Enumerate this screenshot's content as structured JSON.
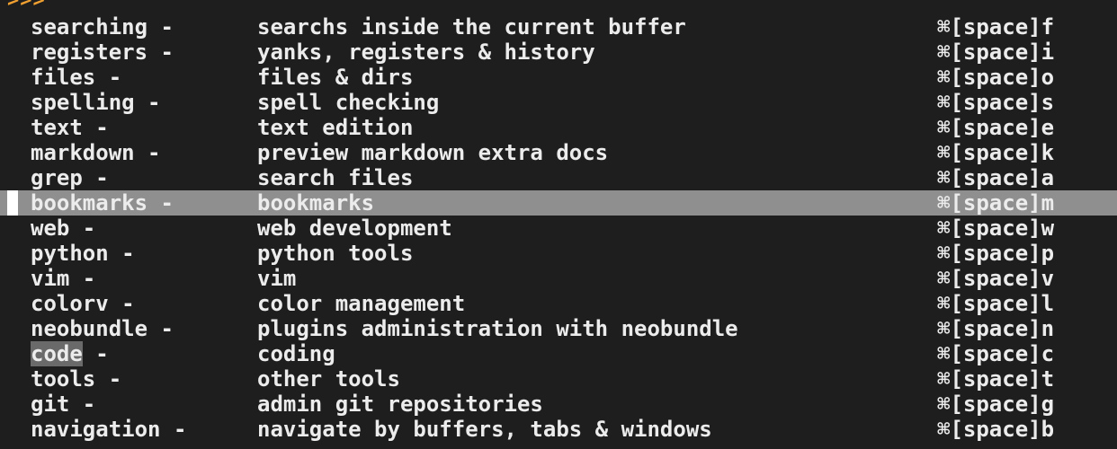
{
  "prompt": ">>>",
  "menu": {
    "items": [
      {
        "name": "searching",
        "suffix": " -",
        "description": "searchs inside the current buffer",
        "shortcut": "⌘[space]f"
      },
      {
        "name": "registers",
        "suffix": " -",
        "description": "yanks, registers & history",
        "shortcut": "⌘[space]i"
      },
      {
        "name": "files",
        "suffix": " -",
        "description": "files & dirs",
        "shortcut": "⌘[space]o"
      },
      {
        "name": "spelling",
        "suffix": " -",
        "description": "spell checking",
        "shortcut": "⌘[space]s"
      },
      {
        "name": "text",
        "suffix": " -",
        "description": "text edition",
        "shortcut": "⌘[space]e"
      },
      {
        "name": "markdown",
        "suffix": " -",
        "description": "preview markdown extra docs",
        "shortcut": "⌘[space]k"
      },
      {
        "name": "grep",
        "suffix": " -",
        "description": "search files",
        "shortcut": "⌘[space]a"
      },
      {
        "name": "bookmarks",
        "suffix": " -",
        "description": "bookmarks",
        "shortcut": "⌘[space]m",
        "selected": true
      },
      {
        "name": "web",
        "suffix": " -",
        "description": "web development",
        "shortcut": "⌘[space]w"
      },
      {
        "name": "python",
        "suffix": " -",
        "description": "python tools",
        "shortcut": "⌘[space]p"
      },
      {
        "name": "vim",
        "suffix": " -",
        "description": "vim",
        "shortcut": "⌘[space]v"
      },
      {
        "name": "colorv",
        "suffix": " -",
        "description": "color management",
        "shortcut": "⌘[space]l"
      },
      {
        "name": "neobundle",
        "suffix": " -",
        "description": "plugins administration with neobundle",
        "shortcut": "⌘[space]n"
      },
      {
        "name": "code",
        "suffix": " -",
        "description": "coding",
        "shortcut": "⌘[space]c",
        "match_highlight": true
      },
      {
        "name": "tools",
        "suffix": " -",
        "description": "other tools",
        "shortcut": "⌘[space]t"
      },
      {
        "name": "git",
        "suffix": " -",
        "description": "admin git repositories",
        "shortcut": "⌘[space]g"
      },
      {
        "name": "navigation",
        "suffix": " -",
        "description": "navigate by buffers, tabs & windows",
        "shortcut": "⌘[space]b"
      }
    ]
  },
  "colors": {
    "background": "#1e1e1e",
    "foreground": "#ececec",
    "prompt": "#f0a030",
    "selected_row": "#8f8f8f",
    "match_highlight": "#6a6a6a",
    "cursor": "#ffffff"
  }
}
